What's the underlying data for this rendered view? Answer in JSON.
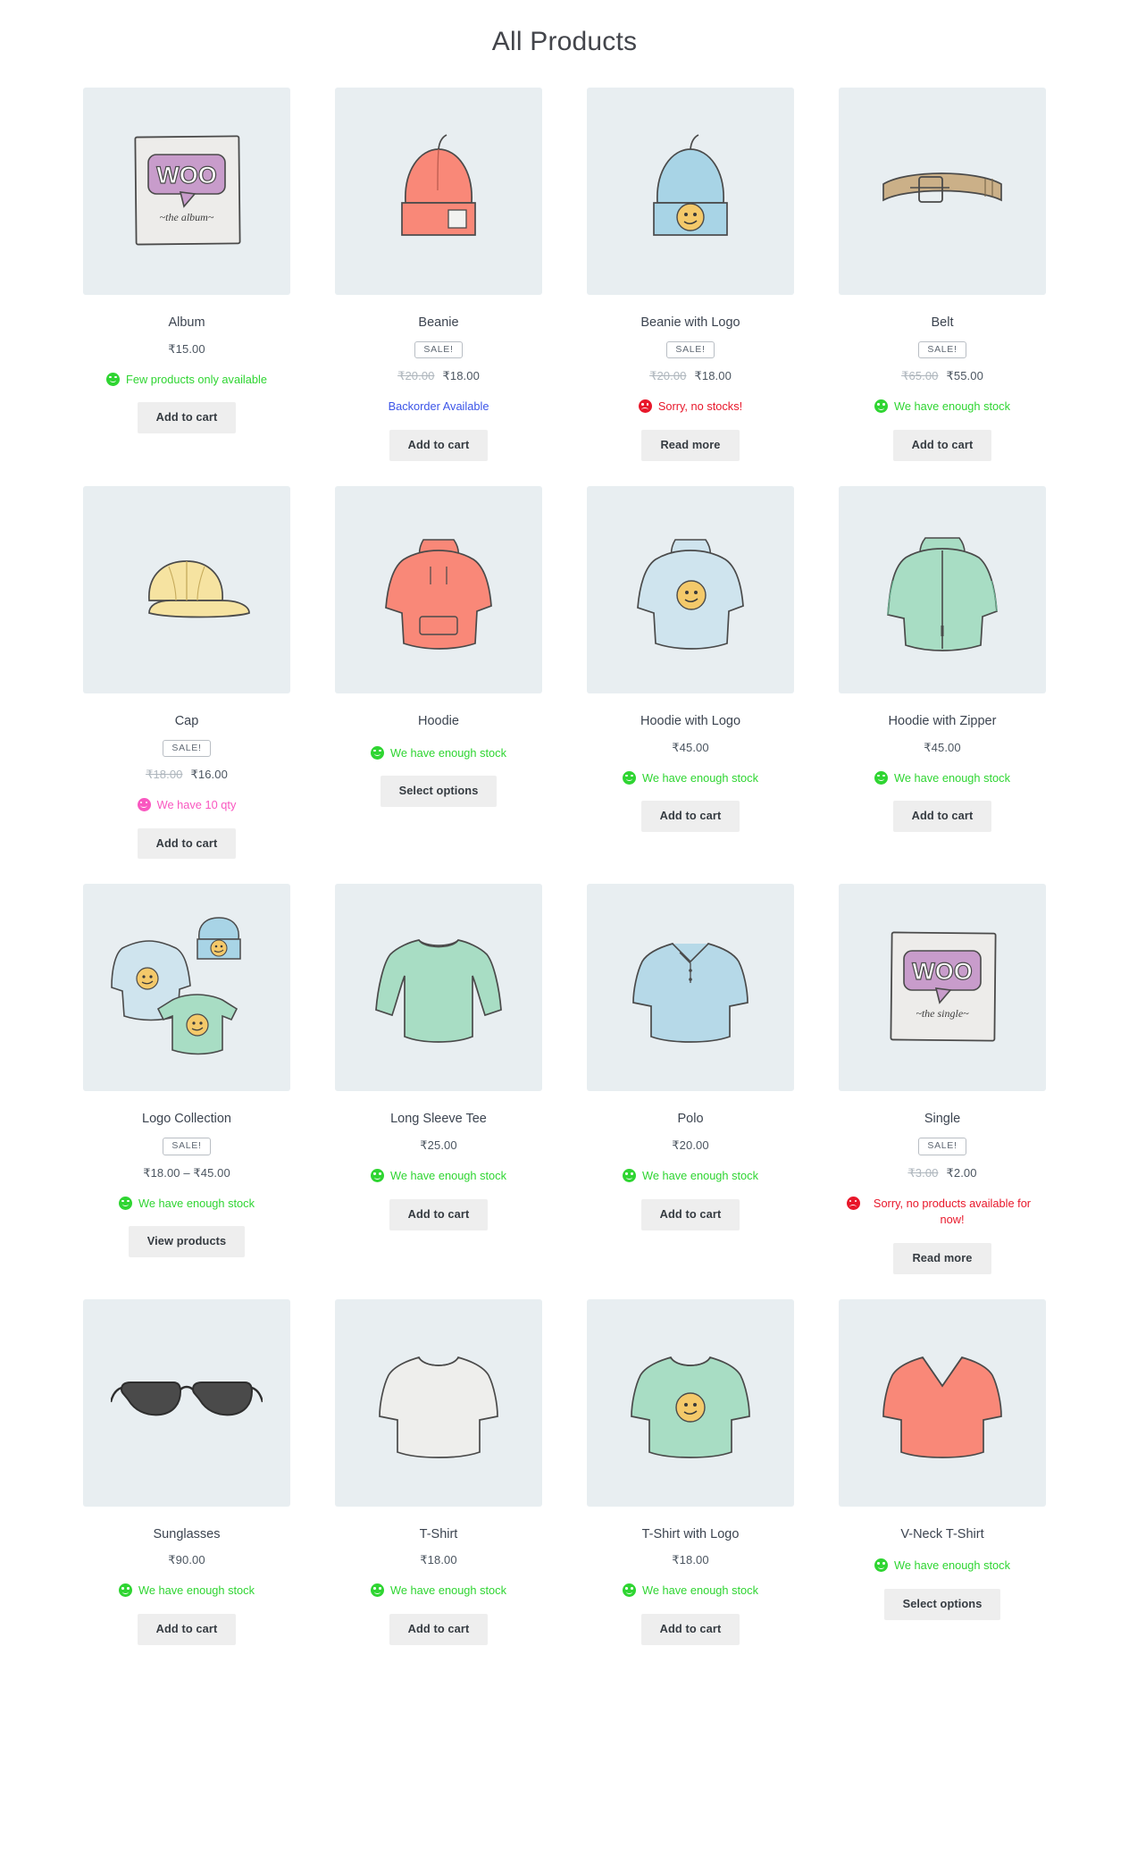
{
  "page": {
    "title": "All Products"
  },
  "colors": {
    "in_stock": "#2fd532",
    "out_of_stock": "#e8172a",
    "backorder": "#3c55e8",
    "custom_qty": "#f957c0",
    "thumb_bg": "#e8eef1",
    "button_bg": "#eeeeee"
  },
  "labels": {
    "sale": "SALE!",
    "add_to_cart": "Add to cart",
    "read_more": "Read more",
    "select_options": "Select options",
    "view_products": "View products"
  },
  "products": [
    {
      "name": "Album",
      "art": "album",
      "on_sale": false,
      "price": "₹15.00",
      "regular_price": "",
      "stock_text": "Few products only available",
      "stock_state": "low",
      "button": "Add to cart"
    },
    {
      "name": "Beanie",
      "art": "beanie",
      "on_sale": true,
      "sale_label": "SALE!",
      "regular_price": "₹20.00",
      "price": "₹18.00",
      "stock_text": "Backorder Available",
      "stock_state": "backorder",
      "button": "Add to cart"
    },
    {
      "name": "Beanie with Logo",
      "art": "beanie-logo",
      "on_sale": true,
      "sale_label": "SALE!",
      "regular_price": "₹20.00",
      "price": "₹18.00",
      "stock_text": "Sorry, no stocks!",
      "stock_state": "out",
      "button": "Read more"
    },
    {
      "name": "Belt",
      "art": "belt",
      "on_sale": true,
      "sale_label": "SALE!",
      "regular_price": "₹65.00",
      "price": "₹55.00",
      "stock_text": "We have enough stock",
      "stock_state": "in",
      "button": "Add to cart"
    },
    {
      "name": "Cap",
      "art": "cap",
      "on_sale": true,
      "sale_label": "SALE!",
      "regular_price": "₹18.00",
      "price": "₹16.00",
      "stock_text": "We have 10 qty",
      "stock_state": "custom",
      "button": "Add to cart"
    },
    {
      "name": "Hoodie",
      "art": "hoodie",
      "on_sale": false,
      "price": "",
      "regular_price": "",
      "stock_text": "We have enough stock",
      "stock_state": "in",
      "button": "Select options"
    },
    {
      "name": "Hoodie with Logo",
      "art": "hoodie-logo",
      "on_sale": false,
      "price": "₹45.00",
      "regular_price": "",
      "stock_text": "We have enough stock",
      "stock_state": "in",
      "button": "Add to cart"
    },
    {
      "name": "Hoodie with Zipper",
      "art": "hoodie-zip",
      "on_sale": false,
      "price": "₹45.00",
      "regular_price": "",
      "stock_text": "We have enough stock",
      "stock_state": "in",
      "button": "Add to cart"
    },
    {
      "name": "Logo Collection",
      "art": "logo-collection",
      "on_sale": true,
      "sale_label": "SALE!",
      "regular_price": "",
      "price": "₹18.00 – ₹45.00",
      "stock_text": "We have enough stock",
      "stock_state": "in",
      "button": "View products"
    },
    {
      "name": "Long Sleeve Tee",
      "art": "long-sleeve",
      "on_sale": false,
      "price": "₹25.00",
      "regular_price": "",
      "stock_text": "We have enough stock",
      "stock_state": "in",
      "button": "Add to cart"
    },
    {
      "name": "Polo",
      "art": "polo",
      "on_sale": false,
      "price": "₹20.00",
      "regular_price": "",
      "stock_text": "We have enough stock",
      "stock_state": "in",
      "button": "Add to cart"
    },
    {
      "name": "Single",
      "art": "single",
      "on_sale": true,
      "sale_label": "SALE!",
      "regular_price": "₹3.00",
      "price": "₹2.00",
      "stock_text": "Sorry, no products available for now!",
      "stock_state": "out",
      "button": "Read more"
    },
    {
      "name": "Sunglasses",
      "art": "sunglasses",
      "on_sale": false,
      "price": "₹90.00",
      "regular_price": "",
      "stock_text": "We have enough stock",
      "stock_state": "in",
      "button": "Add to cart"
    },
    {
      "name": "T-Shirt",
      "art": "tshirt",
      "on_sale": false,
      "price": "₹18.00",
      "regular_price": "",
      "stock_text": "We have enough stock",
      "stock_state": "in",
      "button": "Add to cart"
    },
    {
      "name": "T-Shirt with Logo",
      "art": "tshirt-logo",
      "on_sale": false,
      "price": "₹18.00",
      "regular_price": "",
      "stock_text": "We have enough stock",
      "stock_state": "in",
      "button": "Add to cart"
    },
    {
      "name": "V-Neck T-Shirt",
      "art": "vneck",
      "on_sale": false,
      "price": "",
      "regular_price": "",
      "stock_text": "We have enough stock",
      "stock_state": "in",
      "button": "Select options"
    }
  ]
}
